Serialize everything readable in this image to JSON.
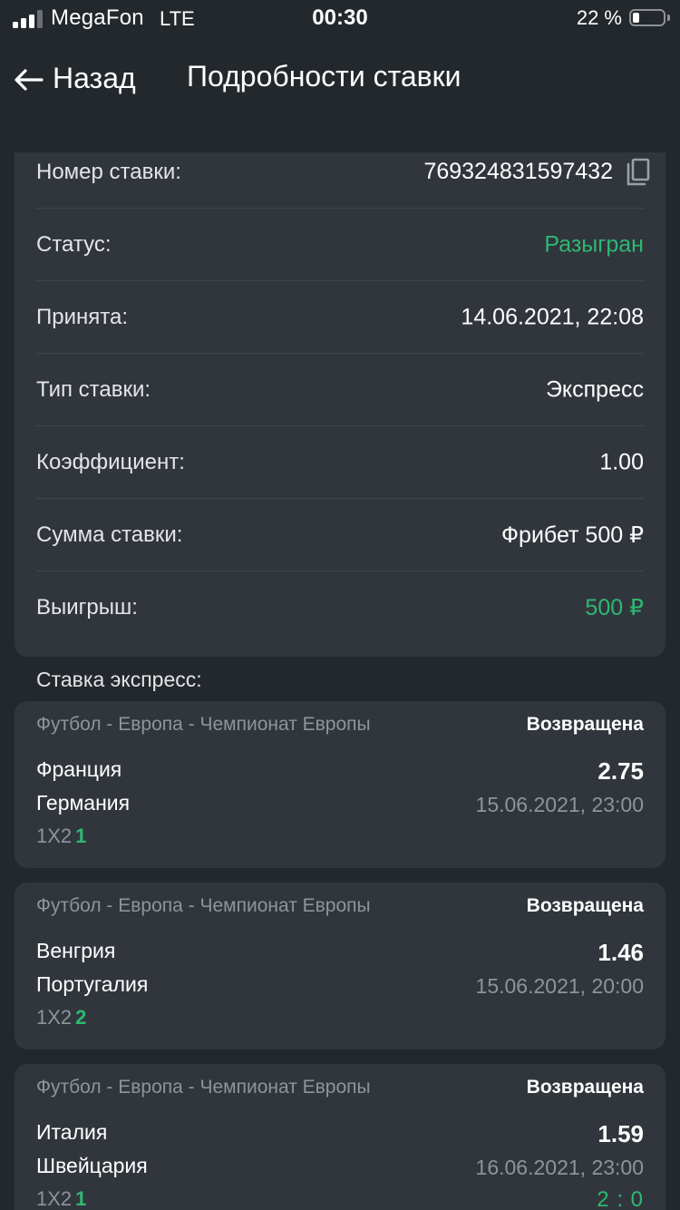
{
  "status_bar": {
    "carrier": "MegaFon",
    "network": "LTE",
    "time": "00:30",
    "battery_percent": "22 %"
  },
  "header": {
    "back_label": "Назад",
    "title": "Подробности ставки"
  },
  "colors": {
    "background": "#23282d",
    "card": "#31363d",
    "accent_green": "#2eb872",
    "muted_text": "#8e949b"
  },
  "bet_info": {
    "number_label": "Номер ставки:",
    "number_value": "769324831597432",
    "status_label": "Статус:",
    "status_value": "Разыгран",
    "accepted_label": "Принята:",
    "accepted_value": "14.06.2021, 22:08",
    "type_label": "Тип ставки:",
    "type_value": "Экспресс",
    "coef_label": "Коэффициент:",
    "coef_value": "1.00",
    "amount_label": "Сумма ставки:",
    "amount_value": "Фрибет 500 ₽",
    "win_label": "Выигрыш:",
    "win_value": "500 ₽"
  },
  "express": {
    "heading": "Ставка экспресс:",
    "events": [
      {
        "league": "Футбол - Европа - Чемпионат Европы",
        "status": "Возвращена",
        "team1": "Франция",
        "team2": "Германия",
        "odds": "2.75",
        "datetime": "15.06.2021, 23:00",
        "market": "1X2",
        "pick": "1",
        "score": ""
      },
      {
        "league": "Футбол - Европа - Чемпионат Европы",
        "status": "Возвращена",
        "team1": "Венгрия",
        "team2": "Португалия",
        "odds": "1.46",
        "datetime": "15.06.2021, 20:00",
        "market": "1X2",
        "pick": "2",
        "score": ""
      },
      {
        "league": "Футбол - Европа - Чемпионат Европы",
        "status": "Возвращена",
        "team1": "Италия",
        "team2": "Швейцария",
        "odds": "1.59",
        "datetime": "16.06.2021, 23:00",
        "market": "1X2",
        "pick": "1",
        "score": "2 : 0"
      }
    ]
  }
}
